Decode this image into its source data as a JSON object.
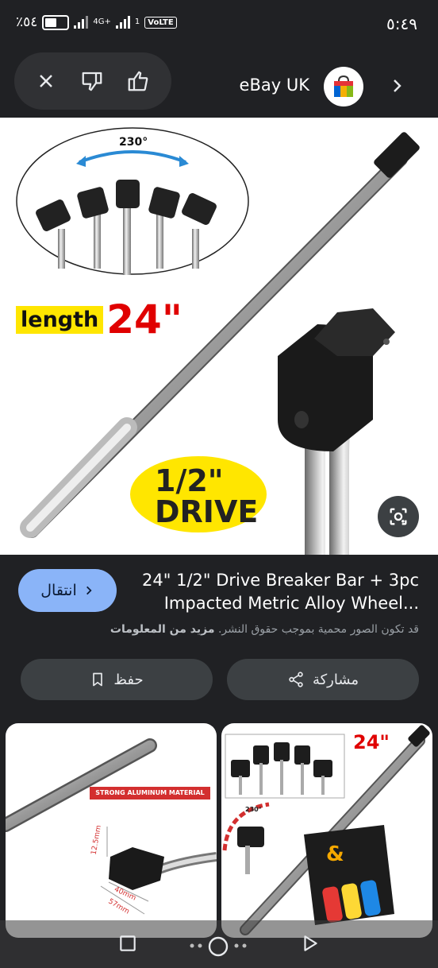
{
  "status": {
    "time": "٥:٤٩",
    "battery": "٪٥٤",
    "network": "4G+",
    "sim": "1",
    "volte": "VoLTE"
  },
  "header": {
    "site_name": "eBay UK",
    "icons": [
      "close-icon",
      "thumbs-down-icon",
      "thumbs-up-icon",
      "chevron-right-icon"
    ]
  },
  "hero": {
    "angle_label": "230°",
    "length_word": "length",
    "length_value": "24\"",
    "drive_size": "1/2\"",
    "drive_word": "DRIVE"
  },
  "result": {
    "visit_label": "انتقال",
    "title_line1": "24\" 1/2\" Drive Breaker Bar + 3pc",
    "title_line2": "Impacted Metric Alloy Wheel...",
    "notice_text": "قد تكون الصور محمية بموجب حقوق النشر.",
    "notice_link": "مزيد من المعلومات",
    "share_label": "مشاركة",
    "save_label": "حفظ"
  },
  "thumbs": {
    "left": {
      "banner": "STRONG ALUMINUM MATERIAL",
      "dim1": "12.5mm",
      "dim2": "40mm",
      "dim3": "57mm"
    },
    "right": {
      "length_value": "24\"",
      "angle_label": "230°",
      "ampersand": "&"
    }
  },
  "colors": {
    "background": "#202124",
    "accent": "#8ab4f8",
    "button": "#3c4043"
  }
}
